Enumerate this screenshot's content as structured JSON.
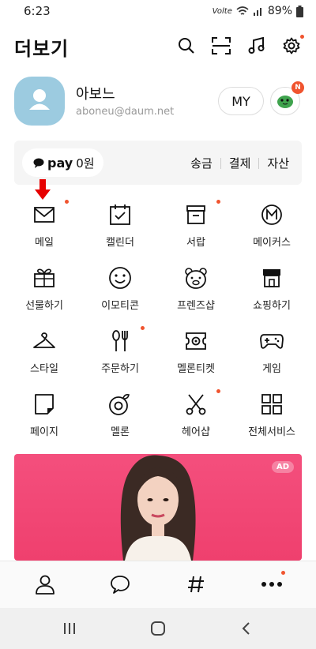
{
  "status": {
    "time": "6:23",
    "network": "Volte",
    "battery": "89%"
  },
  "header": {
    "title": "더보기"
  },
  "profile": {
    "name": "아보느",
    "email": "aboneu@daum.net",
    "my_label": "MY",
    "badge": "N"
  },
  "pay": {
    "logo": "pay",
    "amount": "0원",
    "links": [
      "송금",
      "결제",
      "자산"
    ]
  },
  "grid": [
    [
      {
        "label": "메일",
        "icon": "mail-icon",
        "dot": true
      },
      {
        "label": "캘린더",
        "icon": "calendar-icon",
        "dot": false
      },
      {
        "label": "서랍",
        "icon": "drawer-icon",
        "dot": true
      },
      {
        "label": "메이커스",
        "icon": "makers-icon",
        "dot": false
      }
    ],
    [
      {
        "label": "선물하기",
        "icon": "gift-icon",
        "dot": false
      },
      {
        "label": "이모티콘",
        "icon": "emoticon-icon",
        "dot": false
      },
      {
        "label": "프렌즈샵",
        "icon": "friends-shop-icon",
        "dot": false
      },
      {
        "label": "쇼핑하기",
        "icon": "shopping-icon",
        "dot": false
      }
    ],
    [
      {
        "label": "스타일",
        "icon": "hanger-icon",
        "dot": false
      },
      {
        "label": "주문하기",
        "icon": "fork-spoon-icon",
        "dot": true
      },
      {
        "label": "멜론티켓",
        "icon": "ticket-icon",
        "dot": false
      },
      {
        "label": "게임",
        "icon": "gamepad-icon",
        "dot": false
      }
    ],
    [
      {
        "label": "페이지",
        "icon": "page-icon",
        "dot": false
      },
      {
        "label": "멜론",
        "icon": "melon-icon",
        "dot": false
      },
      {
        "label": "헤어샵",
        "icon": "scissors-icon",
        "dot": true
      },
      {
        "label": "전체서비스",
        "icon": "all-services-icon",
        "dot": false
      }
    ]
  ],
  "ad": {
    "badge": "AD"
  },
  "colors": {
    "accent": "#f0542f",
    "ad_bg": "#f2476f",
    "arrow": "#e60000"
  }
}
